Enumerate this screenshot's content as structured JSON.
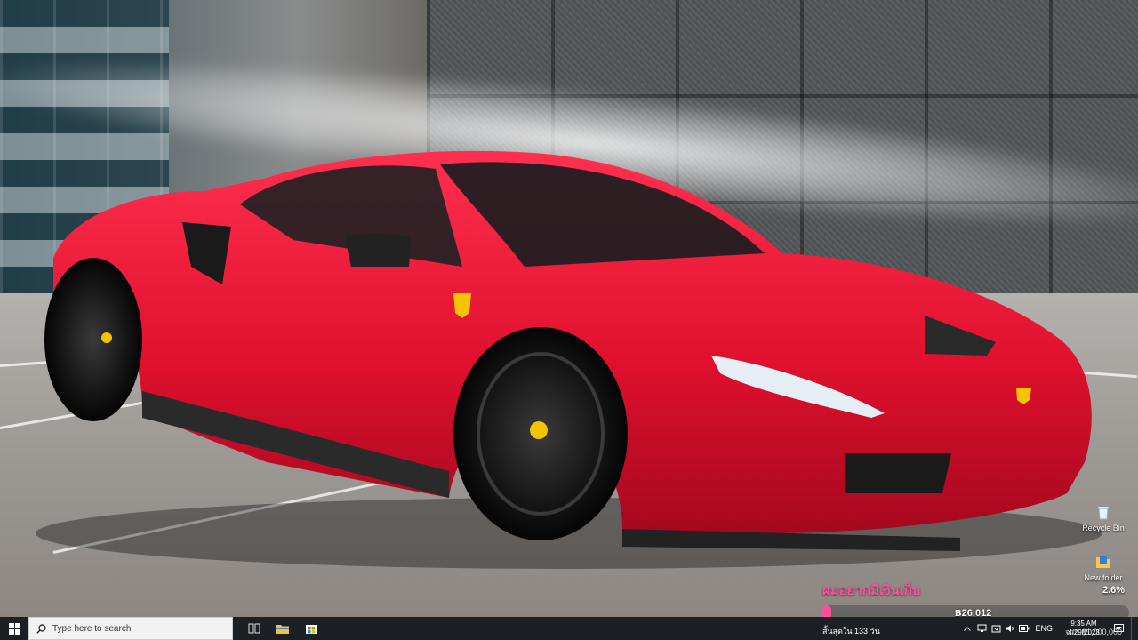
{
  "desktop": {
    "icons": [
      {
        "label": "Recycle Bin",
        "icon": "recycle-bin-icon"
      },
      {
        "label": "New folder",
        "icon": "folder-icon"
      }
    ]
  },
  "savings_widget": {
    "title": "ผมอยากมีเงินเก็บ",
    "percent_label": "2.6%",
    "progress_fraction": 0.026,
    "amount": "฿26,012",
    "days_left": "สิ้นสุดใน 133 วัน",
    "goal": "จาก ฿1,000,000",
    "accent_color": "#ff4f9a"
  },
  "taskbar": {
    "search_placeholder": "Type here to search",
    "pinned": [
      {
        "name": "task-view-icon"
      },
      {
        "name": "file-explorer-icon"
      },
      {
        "name": "microsoft-store-icon"
      }
    ],
    "tray": {
      "language": "ENG",
      "time": "9:35 AM",
      "date": "4/29/2023"
    }
  }
}
